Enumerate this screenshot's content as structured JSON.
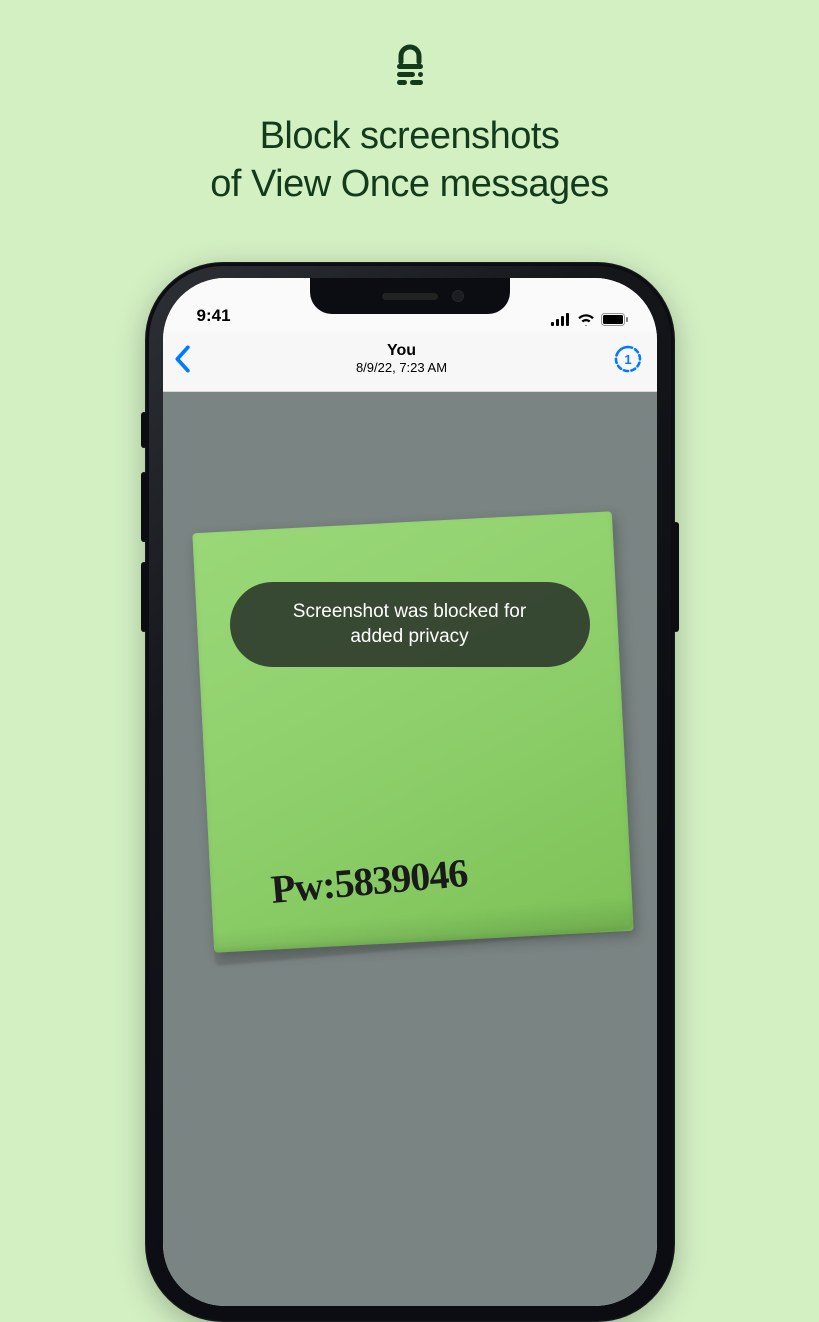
{
  "hero": {
    "headline_line1": "Block screenshots",
    "headline_line2": "of View Once messages"
  },
  "statusbar": {
    "time": "9:41"
  },
  "navbar": {
    "title": "You",
    "subtitle": "8/9/22, 7:23 AM"
  },
  "toast": {
    "line1": "Screenshot was blocked for",
    "line2": "added privacy"
  },
  "sticky_note": {
    "text": "Pw:5839046"
  }
}
